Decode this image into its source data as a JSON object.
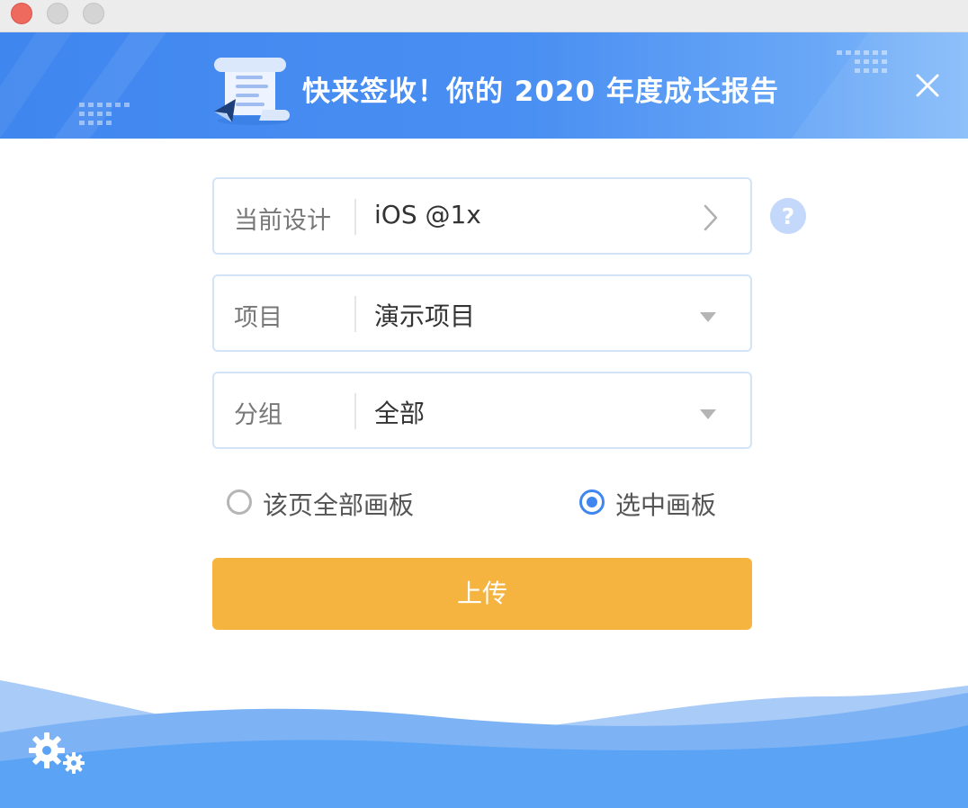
{
  "window": {
    "controls": [
      "close",
      "minimize",
      "zoom"
    ]
  },
  "banner": {
    "title": "快来签收！你的 2020 年度成长报告",
    "icon": "report-scroll-icon",
    "close_icon": "close-icon",
    "background_color": "#4a8ff2"
  },
  "form": {
    "design": {
      "label": "当前设计",
      "value": "iOS @1x",
      "icon": "chevron-right-icon"
    },
    "project": {
      "label": "项目",
      "value": "演示项目",
      "icon": "dropdown-arrow-icon"
    },
    "group": {
      "label": "分组",
      "value": "全部",
      "icon": "dropdown-arrow-icon"
    },
    "help_icon": "?"
  },
  "scope": {
    "options": [
      {
        "label": "该页全部画板",
        "selected": false
      },
      {
        "label": "选中画板",
        "selected": true
      }
    ]
  },
  "upload": {
    "label": "上传",
    "color": "#f4b43f"
  },
  "footer": {
    "settings_icon": "gears-icon"
  }
}
